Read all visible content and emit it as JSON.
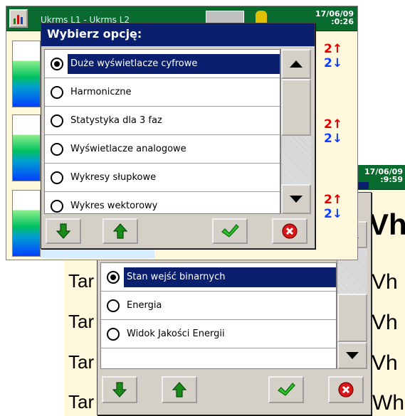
{
  "screen1": {
    "tabs_text": "Ukrms L1 - Ukrms L2",
    "date": "17/06/09",
    "time": ":0:26",
    "rows": [
      {
        "index": "2",
        "dir": "↑",
        "index2": "2",
        "dir2": "↓"
      },
      {
        "index": "2",
        "dir": "↑",
        "index2": "2",
        "dir2": "↓"
      },
      {
        "index": "2",
        "dir": "↑",
        "index2": "2",
        "dir2": "↓"
      }
    ],
    "dialog": {
      "title": "Wybierz opcję:",
      "options": [
        {
          "label": "Duże wyświetlacze cyfrowe",
          "selected": true
        },
        {
          "label": "Harmoniczne",
          "selected": false
        },
        {
          "label": "Statystyka dla 3 faz",
          "selected": false
        },
        {
          "label": "Wyświetlacze analogowe",
          "selected": false
        },
        {
          "label": "Wykresy słupkowe",
          "selected": false
        },
        {
          "label": "Wykres wektorowy",
          "selected": false
        }
      ]
    }
  },
  "screen2": {
    "date": "17/06/09",
    "time": ":9:59",
    "tariff_labels": [
      "Tar",
      "Tar",
      "Tar",
      "Tar"
    ],
    "unit_labels": [
      "Vh",
      "Vh",
      "Vh",
      "Vh",
      "Vh"
    ],
    "bottom_unit": "kWh",
    "dialog": {
      "options": [
        {
          "label": "Stan wejść binarnych",
          "selected": true
        },
        {
          "label": "Energia",
          "selected": false
        },
        {
          "label": "Widok Jakości Energii",
          "selected": false
        }
      ]
    }
  },
  "icons": {
    "down": "green-down-arrow-icon",
    "up": "green-up-arrow-icon",
    "ok": "green-check-icon",
    "cancel": "red-cancel-icon"
  },
  "colors": {
    "title_bar": "#0a1f6e",
    "top_bar": "#0a6b2e",
    "selection": "#0a1f6e"
  }
}
